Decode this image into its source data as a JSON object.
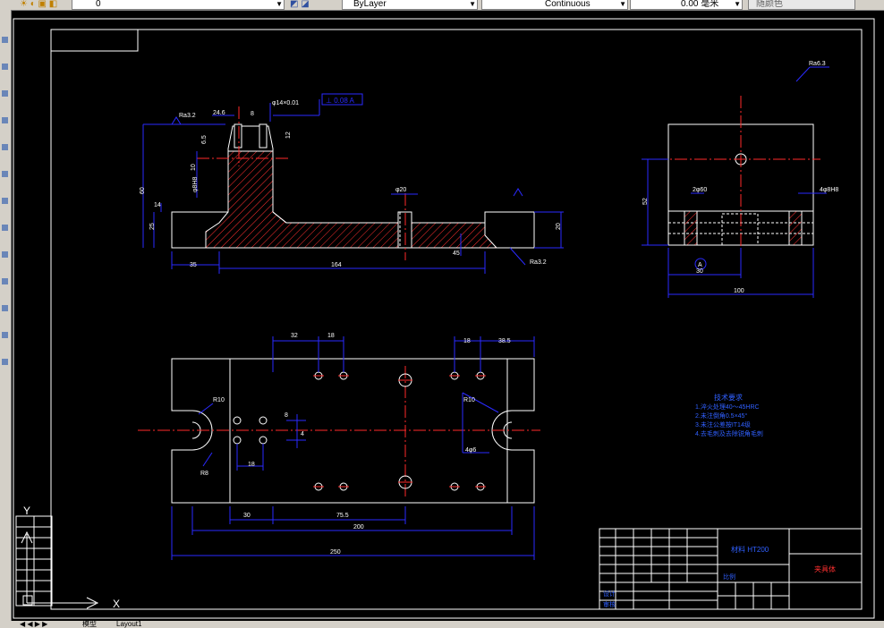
{
  "toolbar": {
    "layer_value": "0",
    "linetype_bylayer": "ByLayer",
    "linetype_continuous": "Continuous",
    "lineweight": "0.00 毫米",
    "plotstyle": "随颜色"
  },
  "statusbar": {
    "tab_model": "模型",
    "tab_layout": "Layout1"
  },
  "drawing": {
    "colors": {
      "border": "#ffffff",
      "dimension": "#2a2aff",
      "centerline": "#ff2a2a",
      "hatch": "#ff3030",
      "text_tech": "#3060ff"
    },
    "top_view": {
      "dims": {
        "d_246": "24.6",
        "d_8": "8",
        "d_phi14": "φ14×0.01",
        "tol_frame": "⊥ 0.08 A",
        "ra_top": "Ra3.2",
        "d_6_5": "6.5",
        "d_12": "12",
        "d_phi8h": "φ8H8",
        "d_10": "10",
        "d_60": "60",
        "d_25": "25",
        "d_14": "14",
        "d_phi20": "φ20",
        "d_ra_right": "Ra3.2",
        "d_35": "35",
        "d_164": "164",
        "d_45": "45",
        "d_20": "20"
      }
    },
    "side_view": {
      "dims": {
        "d_phi60": "2φ60",
        "d_phi8": "4φ8H8",
        "d_52": "52",
        "d_30": "30",
        "d_100": "100",
        "datum": "A",
        "ra_top": "Ra6.3"
      }
    },
    "plan_view": {
      "dims": {
        "d_32": "32",
        "d_18a": "18",
        "d_18b": "18",
        "d_38_5": "38.5",
        "d_r10": "R10",
        "d_r10b": "R10",
        "d_8": "8",
        "d_4": "4",
        "d_18c": "18",
        "d_r8": "R8",
        "d_phi6": "4φ6",
        "d_30": "30",
        "d_75": "75.5",
        "d_200": "200",
        "d_250": "250"
      }
    },
    "tech_requirements": {
      "title": "技术要求",
      "items": [
        "1.淬火处理40～45HRC",
        "2.未注倒角0.5×45°",
        "3.未注公差按IT14级",
        "4.去毛刺及去除锐角毛刺"
      ]
    },
    "title_block": {
      "part_name": "夹具体",
      "material": "材料 HT200",
      "scale": "比例",
      "drawn": "设计",
      "checked": "审核"
    }
  }
}
